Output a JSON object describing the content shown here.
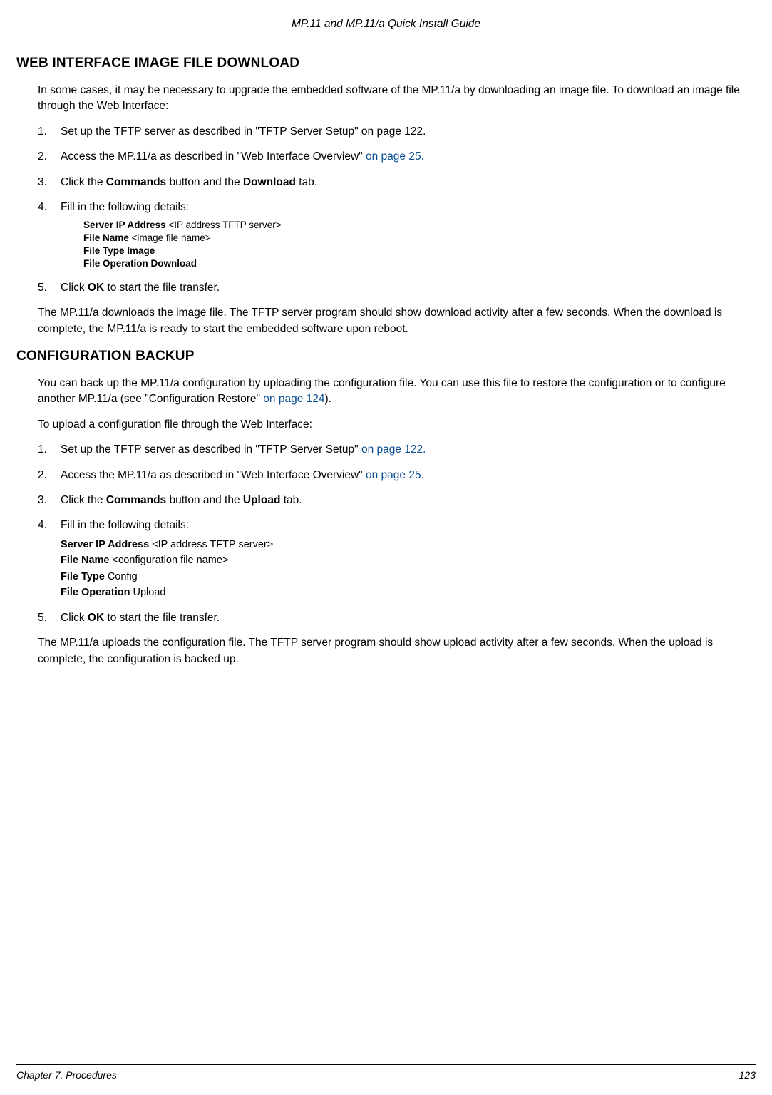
{
  "header": "MP.11 and MP.11/a Quick Install Guide",
  "section1": {
    "title": "WEB INTERFACE IMAGE FILE DOWNLOAD",
    "intro": "In some cases, it may be necessary to upgrade the embedded software of the MP.11/a by downloading an image file.  To download an image file through the Web Interface:",
    "steps": {
      "s1": "Set up the TFTP server as described in \"TFTP Server Setup\" on page 122.",
      "s2a": "Access the MP.11/a as described in \"Web Interface Overview\"",
      "s2b": " on page 25.",
      "s3a": "Click the ",
      "s3b": "Commands",
      "s3c": " button and the ",
      "s3d": "Download",
      "s3e": " tab.",
      "s4": "Fill in the following details:",
      "d1a": "Server IP Address ",
      "d1b": "<IP address TFTP server>",
      "d2a": "File Name ",
      "d2b": "<image file name>",
      "d3": "File Type Image",
      "d4": "File Operation Download",
      "s5a": "Click ",
      "s5b": "OK",
      "s5c": " to start the file transfer."
    },
    "outro": "The MP.11/a downloads the image file. The TFTP server program should show download activity after a few seconds.  When the download is complete, the MP.11/a is ready to start the embedded software upon reboot."
  },
  "section2": {
    "title": "CONFIGURATION BACKUP",
    "intro_a": "You can back up the MP.11/a configuration by uploading the configuration file.   You can use this file to restore the configuration or to configure another MP.11/a (see \"Configuration Restore\"",
    "intro_b": " on page 124",
    "intro_c": ").",
    "intro2": "To upload a configuration file through the Web Interface:",
    "steps": {
      "s1a": "Set up the TFTP server as described in \"TFTP Server Setup\"",
      "s1b": " on page 122.",
      "s2a": "Access the MP.11/a as described in \"Web Interface Overview\"",
      "s2b": " on page 25.",
      "s3a": "Click the ",
      "s3b": "Commands",
      "s3c": " button and the ",
      "s3d": "Upload",
      "s3e": " tab.",
      "s4": "Fill in the following details:",
      "d1a": "Server IP Address ",
      "d1b": "<IP address TFTP server>",
      "d2a": "File Name ",
      "d2b": "<configuration file name>",
      "d3a": "File Type ",
      "d3b": "Config",
      "d4a": "File Operation ",
      "d4b": "Upload",
      "s5a": "Click ",
      "s5b": "OK",
      "s5c": " to start the file transfer."
    },
    "outro": "The MP.11/a uploads the configuration file. The TFTP server program should show upload activity after a few seconds.  When the upload is complete, the configuration is backed up."
  },
  "footer": {
    "left": "Chapter 7.  Procedures",
    "right": "123"
  }
}
